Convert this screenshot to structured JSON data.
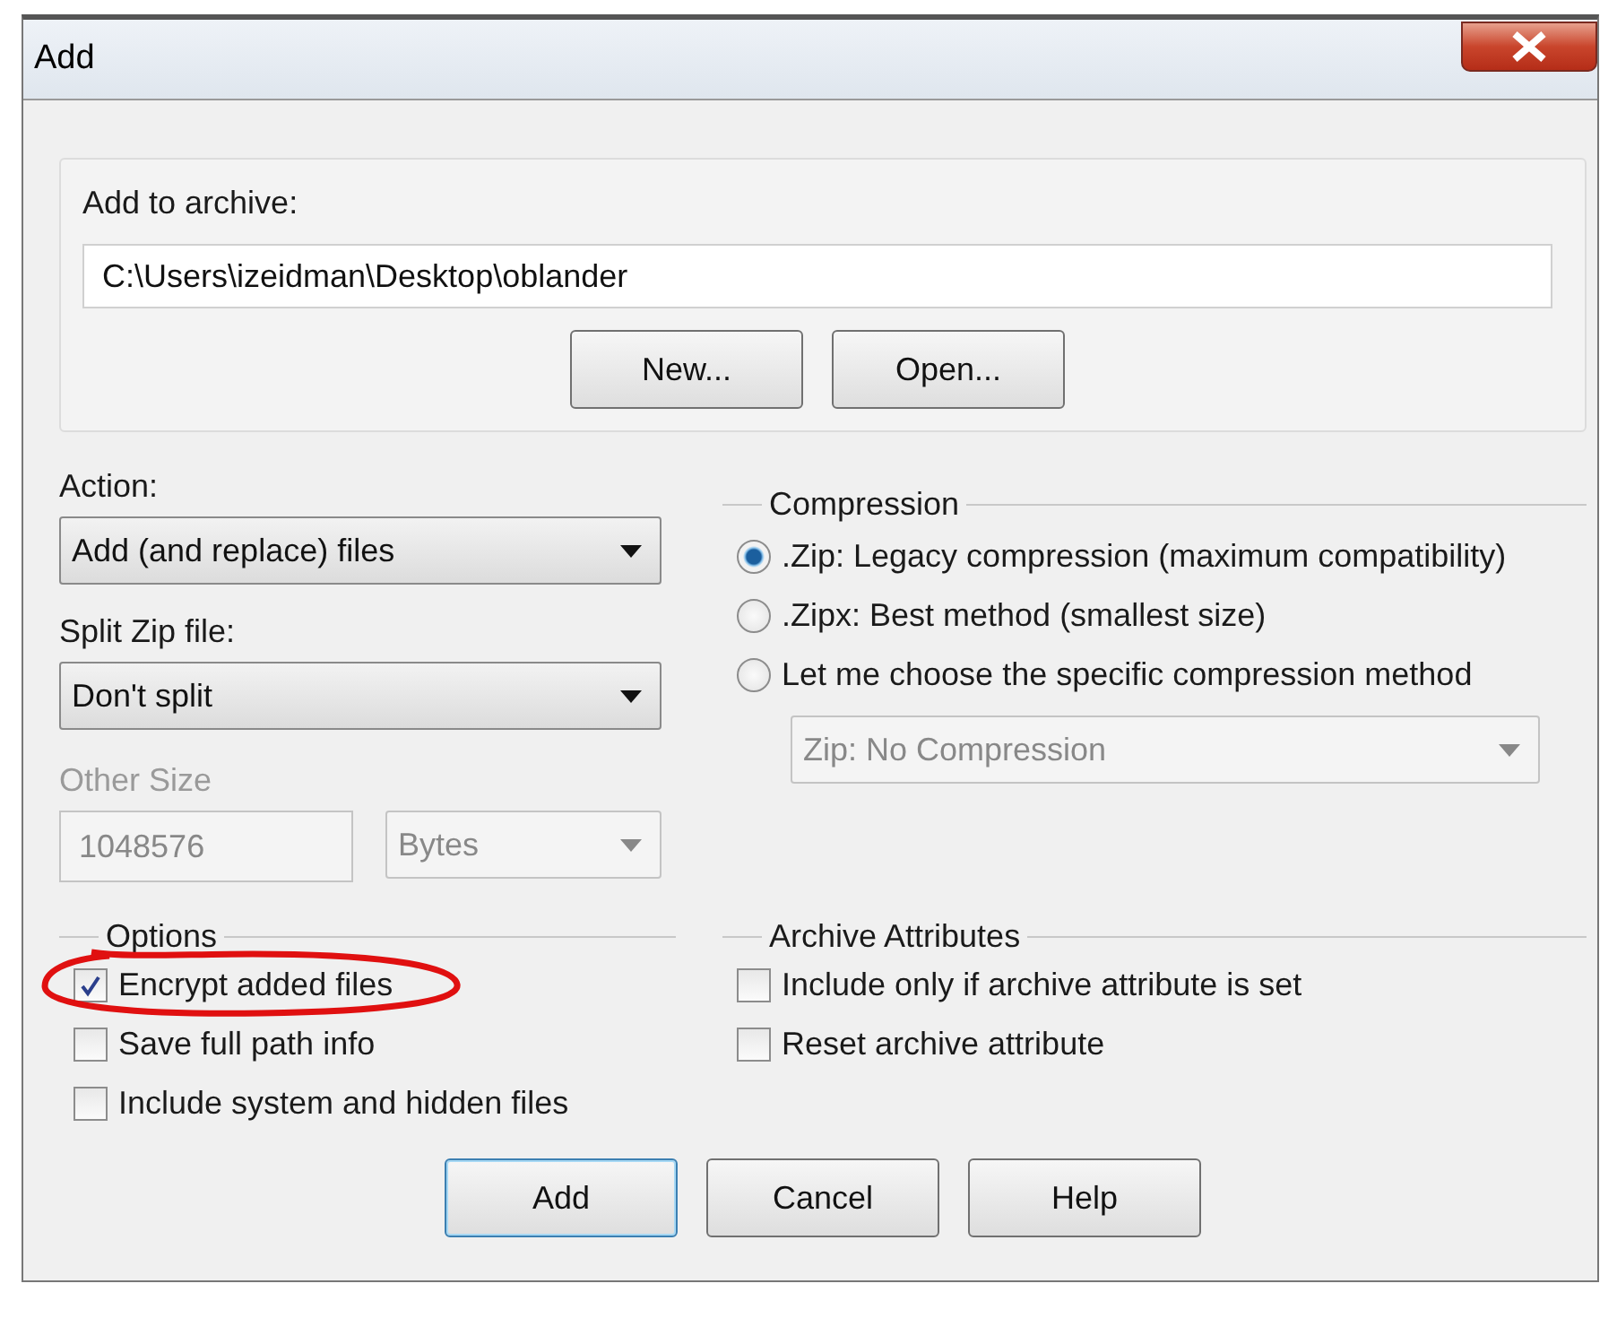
{
  "window": {
    "title": "Add"
  },
  "archive": {
    "label": "Add to archive:",
    "value": "C:\\Users\\izeidman\\Desktop\\oblander",
    "buttons": [
      "New...",
      "Open..."
    ]
  },
  "action": {
    "label": "Action:",
    "value": "Add (and replace) files",
    "disabled": false
  },
  "split": {
    "label": "Split Zip file:",
    "value": "Don't split",
    "disabled": false
  },
  "other_size": {
    "label": "Other Size",
    "value": "1048576",
    "unit": "Bytes",
    "disabled": true
  },
  "compression": {
    "title": "Compression",
    "options": [
      {
        "label": ".Zip: Legacy compression (maximum compatibility)",
        "selected": true
      },
      {
        "label": ".Zipx: Best method (smallest size)",
        "selected": false
      },
      {
        "label": "Let me choose the specific compression method",
        "selected": false
      }
    ],
    "method": {
      "value": "Zip: No Compression",
      "disabled": true
    }
  },
  "options": {
    "title": "Options",
    "items": [
      {
        "label": "Encrypt added files",
        "checked": true
      },
      {
        "label": "Save full path info",
        "checked": false
      },
      {
        "label": "Include system and hidden files",
        "checked": false
      }
    ]
  },
  "archive_attributes": {
    "title": "Archive Attributes",
    "items": [
      {
        "label": "Include only if archive attribute is set",
        "checked": false
      },
      {
        "label": "Reset archive attribute",
        "checked": false
      }
    ]
  },
  "buttons": [
    {
      "label": "Add",
      "default": true
    },
    {
      "label": "Cancel",
      "default": false
    },
    {
      "label": "Help",
      "default": false
    }
  ]
}
